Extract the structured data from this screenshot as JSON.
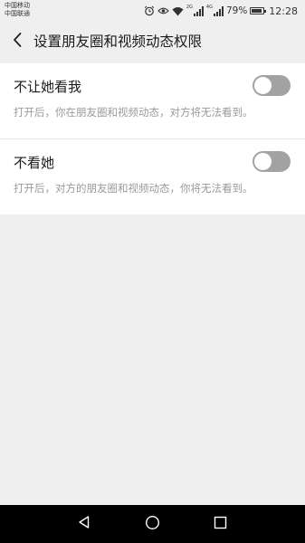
{
  "status_bar": {
    "carrier_1": "中国移动",
    "carrier_2": "中国联通",
    "net_1": "2G",
    "net_2": "4G",
    "battery": "79%",
    "time": "12:28",
    "icons": [
      "alarm-icon",
      "eye-comfort-icon",
      "wifi-icon",
      "signal-icon",
      "battery-icon"
    ]
  },
  "header": {
    "back_icon": "chevron-left-icon",
    "title": "设置朋友圈和视频动态权限"
  },
  "settings": [
    {
      "label": "不让她看我",
      "description": "打开后，你在朋友圈和视频动态，对方将无法看到。",
      "enabled": false
    },
    {
      "label": "不看她",
      "description": "打开后，对方的朋友圈和视频动态，你将无法看到。",
      "enabled": false
    }
  ],
  "colors": {
    "background": "#efefef",
    "card": "#ffffff",
    "toggle_off": "#a2a2a2",
    "description": "#9a9a9a",
    "nav_bar": "#000000"
  },
  "nav_bar": {
    "icons": [
      "nav-back-icon",
      "nav-home-icon",
      "nav-recent-icon"
    ]
  }
}
